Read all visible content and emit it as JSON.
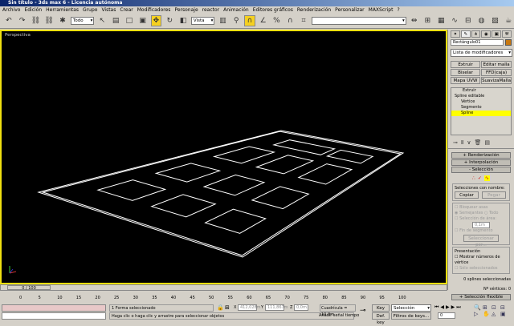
{
  "window": {
    "title": "Sin título - 3ds max 6 - Licencia autónoma"
  },
  "menu": [
    "Archivo",
    "Edición",
    "Herramientas",
    "Grupo",
    "Vistas",
    "Crear",
    "Modificadores",
    "Personaje",
    "reactor",
    "Animación",
    "Editores gráficos",
    "Renderización",
    "Personalizar",
    "MAXScript",
    "?"
  ],
  "toolbar": {
    "selection_filter": "Todo",
    "reference_coord": "Vista",
    "active_tool": "move",
    "snap_active": true
  },
  "viewport": {
    "label": "Perspectiva",
    "background": "#000000",
    "border_color": "#f0e010"
  },
  "panel": {
    "object_name": "Rectángulo01",
    "object_color": "#c87810",
    "modifier_list": "Lista de modificadores",
    "mod_buttons": [
      "Extruir",
      "Editar malla",
      "Biselar",
      "FFD(caja)",
      "Mapa UVW",
      "SuavizaMalla"
    ],
    "stack": [
      {
        "label": "Extruir"
      },
      {
        "label": "Spline editable"
      },
      {
        "label": "Vértice"
      },
      {
        "label": "Segmento"
      },
      {
        "label": "Spline",
        "selected": true
      }
    ],
    "rollouts": {
      "render": "Renderización",
      "interp": "Interpolación",
      "selection": "Selección",
      "soft": "Selección flexible"
    },
    "named_sel": {
      "title": "Selecciones con nombre:",
      "copy": "Copiar",
      "paste": "Pegar"
    },
    "options": {
      "lock": "Bloquear asas",
      "similar": "Semejantes",
      "all": "Todo",
      "area": "Selección de área:",
      "area_value": "0,1m",
      "endpoint": "Fin de segmento",
      "select_by": "Seleccionar por..."
    },
    "display": {
      "title": "Presentación",
      "show_numbers": "Mostrar números de vértice",
      "only_selected": "Sólo seleccionados"
    },
    "splines_selected": "0 splines seleccionadas",
    "vertex_count": "Nº vértices: 0"
  },
  "timeline": {
    "frame": "0 / 100",
    "ticks": [
      "0",
      "5",
      "10",
      "15",
      "20",
      "25",
      "30",
      "35",
      "40",
      "45",
      "50",
      "55",
      "60",
      "65",
      "70",
      "75",
      "80",
      "85",
      "90",
      "95",
      "100"
    ]
  },
  "status": {
    "selected": "1 Forma seleccionado",
    "prompt": "Haga clic o haga clic y arrastre para seleccionar objetos",
    "x": "412,028m",
    "y": "111,867m",
    "z": "0,0m",
    "grid": "Cuadrícula = 10,0m",
    "add_time_tag": "Añadir señal tiempo",
    "key_auto": "Key auto",
    "key_def": "Def. key",
    "key_mode": "Selección",
    "key_filters": "Filtros de keys...",
    "frame_value": "0"
  }
}
